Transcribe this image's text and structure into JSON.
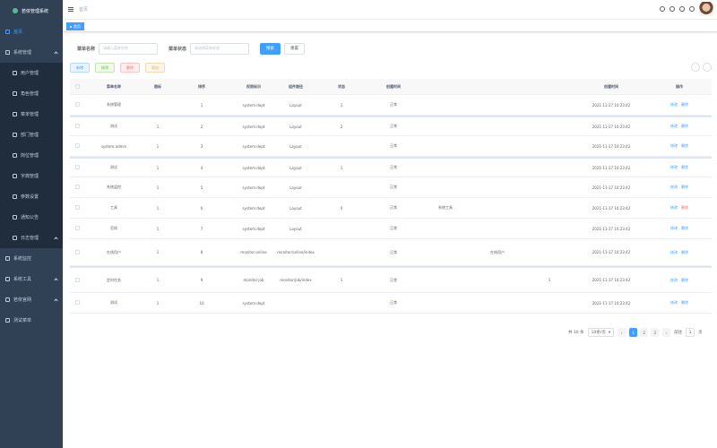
{
  "app": {
    "logo_text": "若依管理系统"
  },
  "sidebar": {
    "items": [
      {
        "label": "首页",
        "icon": "home-icon",
        "active": true
      },
      {
        "label": "系统管理",
        "icon": "system-icon",
        "open": true
      },
      {
        "label": "用户管理",
        "icon": "user-icon",
        "sub": true
      },
      {
        "label": "角色管理",
        "icon": "peoples-icon",
        "sub": true
      },
      {
        "label": "菜单管理",
        "icon": "tree-icon",
        "sub": true
      },
      {
        "label": "部门管理",
        "icon": "tree-table-icon",
        "sub": true
      },
      {
        "label": "岗位管理",
        "icon": "post-icon",
        "sub": true
      },
      {
        "label": "字典管理",
        "icon": "dict-icon",
        "sub": true
      },
      {
        "label": "参数设置",
        "icon": "edit-icon",
        "sub": true
      },
      {
        "label": "通知公告",
        "icon": "message-icon",
        "sub": true
      },
      {
        "label": "日志管理",
        "icon": "log-icon",
        "sub": true,
        "open": true
      },
      {
        "label": "系统监控",
        "icon": "monitor-icon"
      },
      {
        "label": "系统工具",
        "icon": "tool-icon",
        "open": true
      },
      {
        "label": "若依官网",
        "icon": "guide-icon",
        "open": true
      },
      {
        "label": "测试菜单",
        "icon": "menu-icon"
      }
    ]
  },
  "navbar": {
    "breadcrumb": "首页"
  },
  "tags": {
    "active_label": "首页"
  },
  "search": {
    "label_1": "菜单名称",
    "placeholder_1": "请输入菜单名称",
    "label_2": "菜单状态",
    "placeholder_2": "请选择菜单状态",
    "search_label": "搜索",
    "reset_label": "重置"
  },
  "toolbar": {
    "add": "新增",
    "edit": "修改",
    "delete": "删除",
    "export": "导出"
  },
  "table": {
    "columns": [
      "",
      "菜单名称",
      "图标",
      "排序",
      "权限标识",
      "组件路径",
      "状态",
      "创建时间",
      "",
      "",
      "",
      "创建时间",
      "操作"
    ],
    "rows": [
      {
        "name": "系统管理",
        "icon": "",
        "order": "1",
        "perm": "system:dept",
        "comp": "Layout",
        "status": "1",
        "c7": "正常",
        "c8": "",
        "c9": "",
        "c10": "",
        "time": "2021-11-17 10:23:42",
        "edit": "修改",
        "del": "删除",
        "del_red": false,
        "tall": false,
        "thick": false
      },
      {
        "name": "测试",
        "icon": "1",
        "order": "2",
        "perm": "system:dept",
        "comp": "Layout",
        "status": "2",
        "c7": "正常",
        "c8": "",
        "c9": "",
        "c10": "",
        "time": "2021-11-17 10:23:42",
        "edit": "修改",
        "del": "删除",
        "del_red": false,
        "tall": false,
        "thick": true
      },
      {
        "name": "system:admin",
        "icon": "1",
        "order": "3",
        "perm": "system:dept",
        "comp": "Layout",
        "status": "",
        "c7": "正常",
        "c8": "",
        "c9": "",
        "c10": "",
        "time": "2021-11-17 10:23:42",
        "edit": "修改",
        "del": "删除",
        "del_red": false,
        "tall": false,
        "thick": false
      },
      {
        "name": "测试",
        "icon": "1",
        "order": "4",
        "perm": "system:dept",
        "comp": "Layout",
        "status": "1",
        "c7": "正常",
        "c8": "",
        "c9": "",
        "c10": "",
        "time": "2021-11-17 10:23:42",
        "edit": "修改",
        "del": "删除",
        "del_red": false,
        "tall": false,
        "thick": true
      },
      {
        "name": "系统监控",
        "icon": "1",
        "order": "5",
        "perm": "system:dept",
        "comp": "Layout",
        "status": "",
        "c7": "正常",
        "c8": "",
        "c9": "",
        "c10": "",
        "time": "2021-11-17 10:23:42",
        "edit": "修改",
        "del": "删除",
        "del_red": false,
        "tall": false,
        "thick": false
      },
      {
        "name": "工具",
        "icon": "1",
        "order": "6",
        "perm": "system:dept",
        "comp": "Layout",
        "status": "0",
        "c7": "正常",
        "c8": "系统工具",
        "c9": "",
        "c10": "",
        "time": "2021-11-17 10:23:42",
        "edit": "修改",
        "del": "删除",
        "del_red": true,
        "tall": false,
        "thick": false
      },
      {
        "name": "官网",
        "icon": "1",
        "order": "7",
        "perm": "system:dept",
        "comp": "Layout",
        "status": "",
        "c7": "正常",
        "c8": "",
        "c9": "",
        "c10": "",
        "time": "2021-11-17 10:23:42",
        "edit": "修改",
        "del": "删除",
        "del_red": false,
        "tall": false,
        "thick": false
      },
      {
        "name": "在线用户",
        "icon": "1",
        "order": "8",
        "perm": "monitor:online",
        "comp": "monitor/online/index",
        "status": "",
        "c7": "正常",
        "c8": "",
        "c9": "在线用户",
        "c10": "",
        "time": "2021-11-17 10:23:42",
        "edit": "修改",
        "del": "删除",
        "del_red": false,
        "tall": true,
        "thick": false
      },
      {
        "name": "定时任务",
        "icon": "1",
        "order": "9",
        "perm": "monitor:job",
        "comp": "monitor/job/index",
        "status": "1",
        "c7": "正常",
        "c8": "",
        "c9": "",
        "c10": "1",
        "time": "2021-11-17 10:23:42",
        "edit": "修改",
        "del": "删除",
        "del_red": false,
        "tall": true,
        "thick": true
      },
      {
        "name": "测试",
        "icon": "1",
        "order": "10",
        "perm": "system:dept",
        "comp": "",
        "status": "",
        "c7": "正常",
        "c8": "",
        "c9": "",
        "c10": "",
        "time": "2021-11-17 10:23:42",
        "edit": "修改",
        "del": "删除",
        "del_red": false,
        "tall": false,
        "thick": false
      }
    ]
  },
  "pagination": {
    "total": "共 10 条",
    "page_size": "10条/页",
    "pages": [
      "1",
      "2",
      "3"
    ],
    "active_page": "1",
    "jump_label": "前往",
    "jump_value": "1",
    "jump_suffix": "页"
  }
}
